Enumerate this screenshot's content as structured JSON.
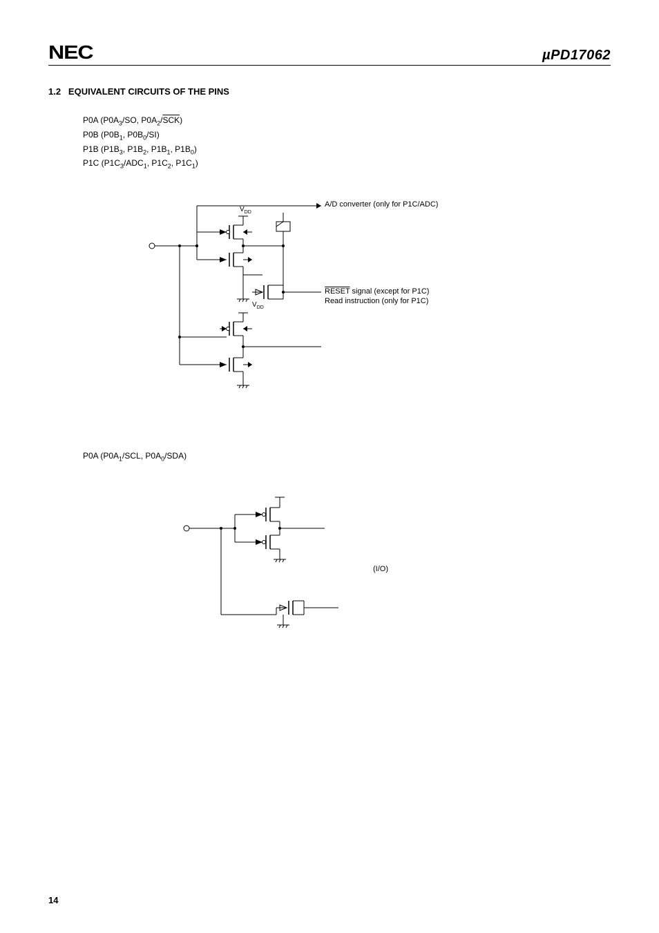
{
  "header": {
    "logo": "NEC",
    "part_prefix": "µ",
    "part_number": "PD17062"
  },
  "section": {
    "number": "1.2",
    "title": "EQUIVALENT CIRCUITS OF THE PINS"
  },
  "pin_list_1": {
    "line1_pre": "P0A (P0A",
    "line1_sub1": "3",
    "line1_mid1": "/SO, P0A",
    "line1_sub2": "2",
    "line1_mid2": "/",
    "line1_overline": "SCK",
    "line1_end": ")",
    "line2_pre": "P0B (P0B",
    "line2_sub1": "1",
    "line2_mid": ", P0B",
    "line2_sub2": "0",
    "line2_end": "/SI)",
    "line3_pre": "P1B (P1B",
    "line3_sub1": "3",
    "line3_mid1": ", P1B",
    "line3_sub2": "2",
    "line3_mid2": ", P1B",
    "line3_sub3": "1",
    "line3_mid3": ", P1B",
    "line3_sub4": "0",
    "line3_end": ")",
    "line4_pre": "P1C (P1C",
    "line4_sub1": "3",
    "line4_mid1": "/ADC",
    "line4_sub2": "1",
    "line4_mid2": ", P1C",
    "line4_sub3": "2",
    "line4_mid3": ", P1C",
    "line4_sub4": "1",
    "line4_end": ")"
  },
  "diagram1_labels": {
    "ad_converter": "A/D converter (only for P1C/ADC)",
    "vdd_v": "V",
    "vdd_dd": "DD",
    "reset_overline": "RESET",
    "reset_text": " signal (except for P1C)",
    "read_instruction": "Read instruction (only for P1C)"
  },
  "pin_list_2": {
    "pre": "P0A (P0A",
    "sub1": "1",
    "mid": "/SCL, P0A",
    "sub2": "0",
    "end": "/SDA)"
  },
  "diagram2_labels": {
    "io": "(I/O)"
  },
  "page_number": "14"
}
